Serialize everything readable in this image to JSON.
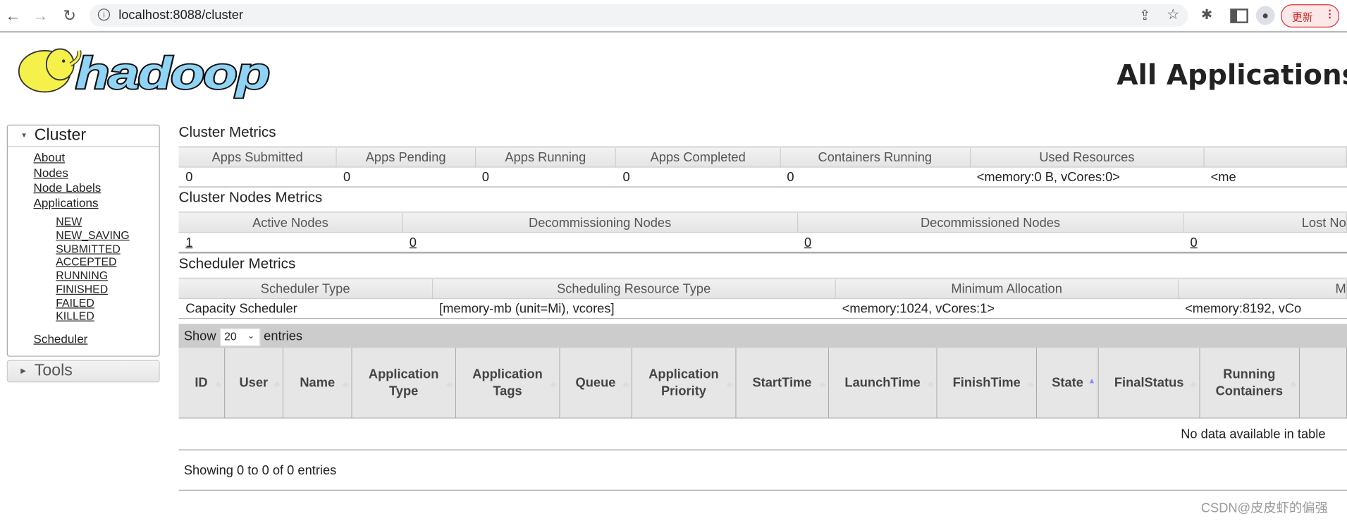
{
  "browser": {
    "url": "localhost:8088/cluster",
    "update_label": "更新",
    "icons": [
      "back-icon",
      "forward-icon",
      "reload-icon",
      "info-icon",
      "share-icon",
      "star-icon",
      "extensions-icon",
      "sidepanel-icon",
      "profile-icon",
      "menu-icon"
    ]
  },
  "logo": {
    "text": "hadoop"
  },
  "page_title": "All Applications",
  "sidebar": {
    "cluster_label": "Cluster",
    "links": [
      "About",
      "Nodes",
      "Node Labels",
      "Applications"
    ],
    "app_states": [
      "NEW",
      "NEW_SAVING",
      "SUBMITTED",
      "ACCEPTED",
      "RUNNING",
      "FINISHED",
      "FAILED",
      "KILLED"
    ],
    "scheduler": "Scheduler",
    "tools_label": "Tools"
  },
  "cluster_metrics": {
    "title": "Cluster Metrics",
    "headers": [
      "Apps Submitted",
      "Apps Pending",
      "Apps Running",
      "Apps Completed",
      "Containers Running",
      "Used Resources",
      ""
    ],
    "values": [
      "0",
      "0",
      "0",
      "0",
      "0",
      "<memory:0 B, vCores:0>",
      "<me"
    ]
  },
  "nodes_metrics": {
    "title": "Cluster Nodes Metrics",
    "headers": [
      "Active Nodes",
      "Decommissioning Nodes",
      "Decommissioned Nodes",
      "Lost No"
    ],
    "values": [
      "1",
      "0",
      "0",
      "0"
    ]
  },
  "scheduler_metrics": {
    "title": "Scheduler Metrics",
    "headers": [
      "Scheduler Type",
      "Scheduling Resource Type",
      "Minimum Allocation",
      "M"
    ],
    "values": [
      "Capacity Scheduler",
      "[memory-mb (unit=Mi), vcores]",
      "<memory:1024, vCores:1>",
      "<memory:8192, vCo"
    ]
  },
  "apps_table": {
    "show_label": "Show",
    "entries_label": "entries",
    "page_size": "20",
    "columns": [
      "ID",
      "User",
      "Name",
      "Application Type",
      "Application Tags",
      "Queue",
      "Application Priority",
      "StartTime",
      "LaunchTime",
      "FinishTime",
      "State",
      "FinalStatus",
      "Running Containers",
      ""
    ],
    "sorted_column": "State",
    "sort_direction": "ascending",
    "empty_message": "No data available in table",
    "info": "Showing 0 to 0 of 0 entries"
  },
  "watermark": "CSDN@皮皮虾的偏强"
}
